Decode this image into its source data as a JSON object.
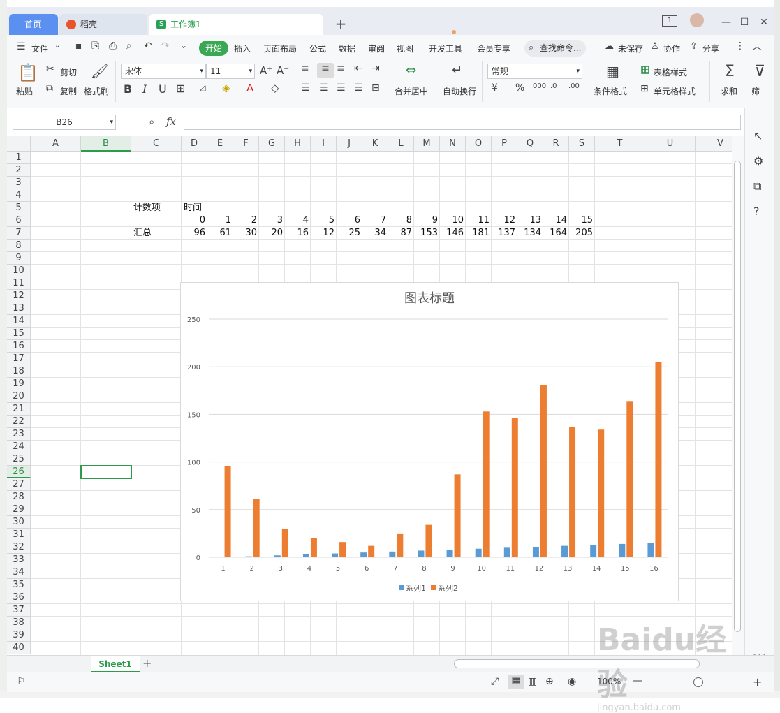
{
  "tabs": [
    {
      "label": "首页"
    },
    {
      "label": "稻壳"
    },
    {
      "label": "工作簿1"
    }
  ],
  "window": {
    "page_indicator": "1"
  },
  "menu": {
    "file": "文件",
    "items": [
      "开始",
      "插入",
      "页面布局",
      "公式",
      "数据",
      "审阅",
      "视图",
      "开发工具",
      "会员专享"
    ],
    "search": "查找命令...",
    "unsaved": "未保存",
    "collab": "协作",
    "share": "分享"
  },
  "ribbon": {
    "paste": "粘贴",
    "cut": "剪切",
    "copy": "复制",
    "format_painter": "格式刷",
    "font_name": "宋体",
    "font_size": "11",
    "merge_center": "合并居中",
    "wrap_text": "自动换行",
    "number_format": "常规",
    "conditional_format": "条件格式",
    "table_style": "表格样式",
    "cell_style": "单元格样式",
    "sum": "求和",
    "filter": "筛"
  },
  "formula_bar": {
    "name_box": "B26",
    "fx": "fx",
    "value": ""
  },
  "grid": {
    "columns": [
      "A",
      "B",
      "C",
      "D",
      "E",
      "F",
      "G",
      "H",
      "I",
      "J",
      "K",
      "L",
      "M",
      "N",
      "O",
      "P",
      "Q",
      "R",
      "S",
      "T",
      "U",
      "V"
    ],
    "rows": [
      "1",
      "2",
      "3",
      "4",
      "5",
      "6",
      "7",
      "8",
      "9",
      "10",
      "11",
      "12",
      "13",
      "14",
      "15",
      "16",
      "17",
      "18",
      "19",
      "20",
      "21",
      "22",
      "23",
      "24",
      "25",
      "26",
      "27",
      "28",
      "29",
      "30",
      "31",
      "32",
      "33",
      "34",
      "35",
      "36",
      "37",
      "38",
      "39",
      "40"
    ],
    "selected_cell": "B26",
    "cells": {
      "c5": "计数项",
      "d5": "时间",
      "c7": "汇总",
      "row6": [
        "0",
        "1",
        "2",
        "3",
        "4",
        "5",
        "6",
        "7",
        "8",
        "9",
        "10",
        "11",
        "12",
        "13",
        "14",
        "15"
      ],
      "row7": [
        "96",
        "61",
        "30",
        "20",
        "16",
        "12",
        "25",
        "34",
        "87",
        "153",
        "146",
        "181",
        "137",
        "134",
        "164",
        "205"
      ]
    }
  },
  "sheets": {
    "active": "Sheet1"
  },
  "status": {
    "zoom": "100%"
  },
  "chart_data": {
    "type": "bar",
    "title": "图表标题",
    "categories": [
      "1",
      "2",
      "3",
      "4",
      "5",
      "6",
      "7",
      "8",
      "9",
      "10",
      "11",
      "12",
      "13",
      "14",
      "15",
      "16"
    ],
    "series": [
      {
        "name": "系列1",
        "values": [
          0,
          1,
          2,
          3,
          4,
          5,
          6,
          7,
          8,
          9,
          10,
          11,
          12,
          13,
          14,
          15
        ],
        "color": "#5b9bd5"
      },
      {
        "name": "系列2",
        "values": [
          96,
          61,
          30,
          20,
          16,
          12,
          25,
          34,
          87,
          153,
          146,
          181,
          137,
          134,
          164,
          205
        ],
        "color": "#ed7d31"
      }
    ],
    "yticks": [
      "0",
      "50",
      "100",
      "150",
      "200",
      "250"
    ],
    "ylim": [
      0,
      250
    ],
    "grid": true,
    "legend": "bottom"
  },
  "watermark": "Baidu经验",
  "watermark_url": "jingyan.baidu.com"
}
